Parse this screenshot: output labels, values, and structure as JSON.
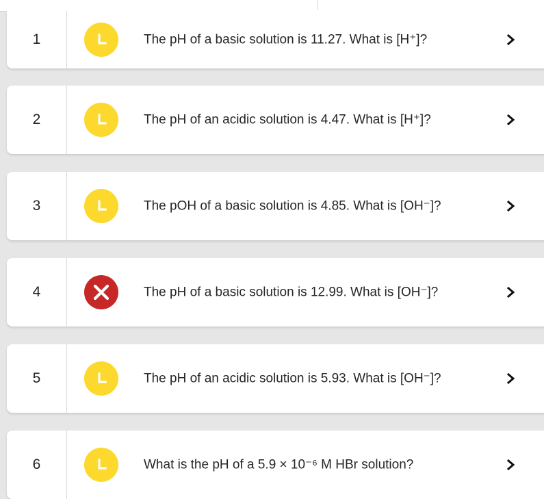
{
  "colors": {
    "late_status": "#fcd92c",
    "incorrect_status": "#c62828",
    "background": "#e6e6e6"
  },
  "questions": [
    {
      "number": "1",
      "status": "late",
      "status_icon": "clock-icon",
      "text": "The pH of a basic solution is 11.27. What is [H⁺]?"
    },
    {
      "number": "2",
      "status": "late",
      "status_icon": "clock-icon",
      "text": "The pH of an acidic solution is 4.47. What is [H⁺]?"
    },
    {
      "number": "3",
      "status": "late",
      "status_icon": "clock-icon",
      "text": "The pOH of a basic solution is 4.85. What is [OH⁻]?"
    },
    {
      "number": "4",
      "status": "incorrect",
      "status_icon": "x-icon",
      "text": "The pH of a basic solution is 12.99. What is [OH⁻]?"
    },
    {
      "number": "5",
      "status": "late",
      "status_icon": "clock-icon",
      "text": "The pH of an acidic solution is 5.93. What is [OH⁻]?"
    },
    {
      "number": "6",
      "status": "late",
      "status_icon": "clock-icon",
      "text": "What is the pH of a 5.9 × 10⁻⁶ M HBr solution?"
    }
  ]
}
